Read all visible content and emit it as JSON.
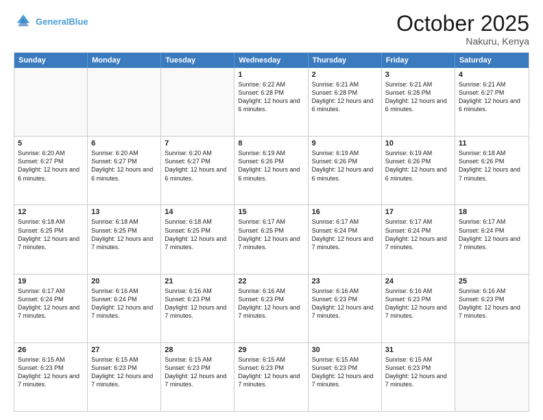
{
  "header": {
    "logo_general": "General",
    "logo_blue": "Blue",
    "month": "October 2025",
    "location": "Nakuru, Kenya"
  },
  "days_of_week": [
    "Sunday",
    "Monday",
    "Tuesday",
    "Wednesday",
    "Thursday",
    "Friday",
    "Saturday"
  ],
  "weeks": [
    [
      {
        "day": "",
        "text": "",
        "empty": true
      },
      {
        "day": "",
        "text": "",
        "empty": true
      },
      {
        "day": "",
        "text": "",
        "empty": true
      },
      {
        "day": "1",
        "text": "Sunrise: 6:22 AM\nSunset: 6:28 PM\nDaylight: 12 hours\nand 6 minutes."
      },
      {
        "day": "2",
        "text": "Sunrise: 6:21 AM\nSunset: 6:28 PM\nDaylight: 12 hours\nand 6 minutes."
      },
      {
        "day": "3",
        "text": "Sunrise: 6:21 AM\nSunset: 6:28 PM\nDaylight: 12 hours\nand 6 minutes."
      },
      {
        "day": "4",
        "text": "Sunrise: 6:21 AM\nSunset: 6:27 PM\nDaylight: 12 hours\nand 6 minutes."
      }
    ],
    [
      {
        "day": "5",
        "text": "Sunrise: 6:20 AM\nSunset: 6:27 PM\nDaylight: 12 hours\nand 6 minutes."
      },
      {
        "day": "6",
        "text": "Sunrise: 6:20 AM\nSunset: 6:27 PM\nDaylight: 12 hours\nand 6 minutes."
      },
      {
        "day": "7",
        "text": "Sunrise: 6:20 AM\nSunset: 6:27 PM\nDaylight: 12 hours\nand 6 minutes."
      },
      {
        "day": "8",
        "text": "Sunrise: 6:19 AM\nSunset: 6:26 PM\nDaylight: 12 hours\nand 6 minutes."
      },
      {
        "day": "9",
        "text": "Sunrise: 6:19 AM\nSunset: 6:26 PM\nDaylight: 12 hours\nand 6 minutes."
      },
      {
        "day": "10",
        "text": "Sunrise: 6:19 AM\nSunset: 6:26 PM\nDaylight: 12 hours\nand 6 minutes."
      },
      {
        "day": "11",
        "text": "Sunrise: 6:18 AM\nSunset: 6:26 PM\nDaylight: 12 hours\nand 7 minutes."
      }
    ],
    [
      {
        "day": "12",
        "text": "Sunrise: 6:18 AM\nSunset: 6:25 PM\nDaylight: 12 hours\nand 7 minutes."
      },
      {
        "day": "13",
        "text": "Sunrise: 6:18 AM\nSunset: 6:25 PM\nDaylight: 12 hours\nand 7 minutes."
      },
      {
        "day": "14",
        "text": "Sunrise: 6:18 AM\nSunset: 6:25 PM\nDaylight: 12 hours\nand 7 minutes."
      },
      {
        "day": "15",
        "text": "Sunrise: 6:17 AM\nSunset: 6:25 PM\nDaylight: 12 hours\nand 7 minutes."
      },
      {
        "day": "16",
        "text": "Sunrise: 6:17 AM\nSunset: 6:24 PM\nDaylight: 12 hours\nand 7 minutes."
      },
      {
        "day": "17",
        "text": "Sunrise: 6:17 AM\nSunset: 6:24 PM\nDaylight: 12 hours\nand 7 minutes."
      },
      {
        "day": "18",
        "text": "Sunrise: 6:17 AM\nSunset: 6:24 PM\nDaylight: 12 hours\nand 7 minutes."
      }
    ],
    [
      {
        "day": "19",
        "text": "Sunrise: 6:17 AM\nSunset: 6:24 PM\nDaylight: 12 hours\nand 7 minutes."
      },
      {
        "day": "20",
        "text": "Sunrise: 6:16 AM\nSunset: 6:24 PM\nDaylight: 12 hours\nand 7 minutes."
      },
      {
        "day": "21",
        "text": "Sunrise: 6:16 AM\nSunset: 6:23 PM\nDaylight: 12 hours\nand 7 minutes."
      },
      {
        "day": "22",
        "text": "Sunrise: 6:16 AM\nSunset: 6:23 PM\nDaylight: 12 hours\nand 7 minutes."
      },
      {
        "day": "23",
        "text": "Sunrise: 6:16 AM\nSunset: 6:23 PM\nDaylight: 12 hours\nand 7 minutes."
      },
      {
        "day": "24",
        "text": "Sunrise: 6:16 AM\nSunset: 6:23 PM\nDaylight: 12 hours\nand 7 minutes."
      },
      {
        "day": "25",
        "text": "Sunrise: 6:16 AM\nSunset: 6:23 PM\nDaylight: 12 hours\nand 7 minutes."
      }
    ],
    [
      {
        "day": "26",
        "text": "Sunrise: 6:15 AM\nSunset: 6:23 PM\nDaylight: 12 hours\nand 7 minutes."
      },
      {
        "day": "27",
        "text": "Sunrise: 6:15 AM\nSunset: 6:23 PM\nDaylight: 12 hours\nand 7 minutes."
      },
      {
        "day": "28",
        "text": "Sunrise: 6:15 AM\nSunset: 6:23 PM\nDaylight: 12 hours\nand 7 minutes."
      },
      {
        "day": "29",
        "text": "Sunrise: 6:15 AM\nSunset: 6:23 PM\nDaylight: 12 hours\nand 7 minutes."
      },
      {
        "day": "30",
        "text": "Sunrise: 6:15 AM\nSunset: 6:23 PM\nDaylight: 12 hours\nand 7 minutes."
      },
      {
        "day": "31",
        "text": "Sunrise: 6:15 AM\nSunset: 6:23 PM\nDaylight: 12 hours\nand 7 minutes."
      },
      {
        "day": "",
        "text": "",
        "empty": true
      }
    ]
  ]
}
